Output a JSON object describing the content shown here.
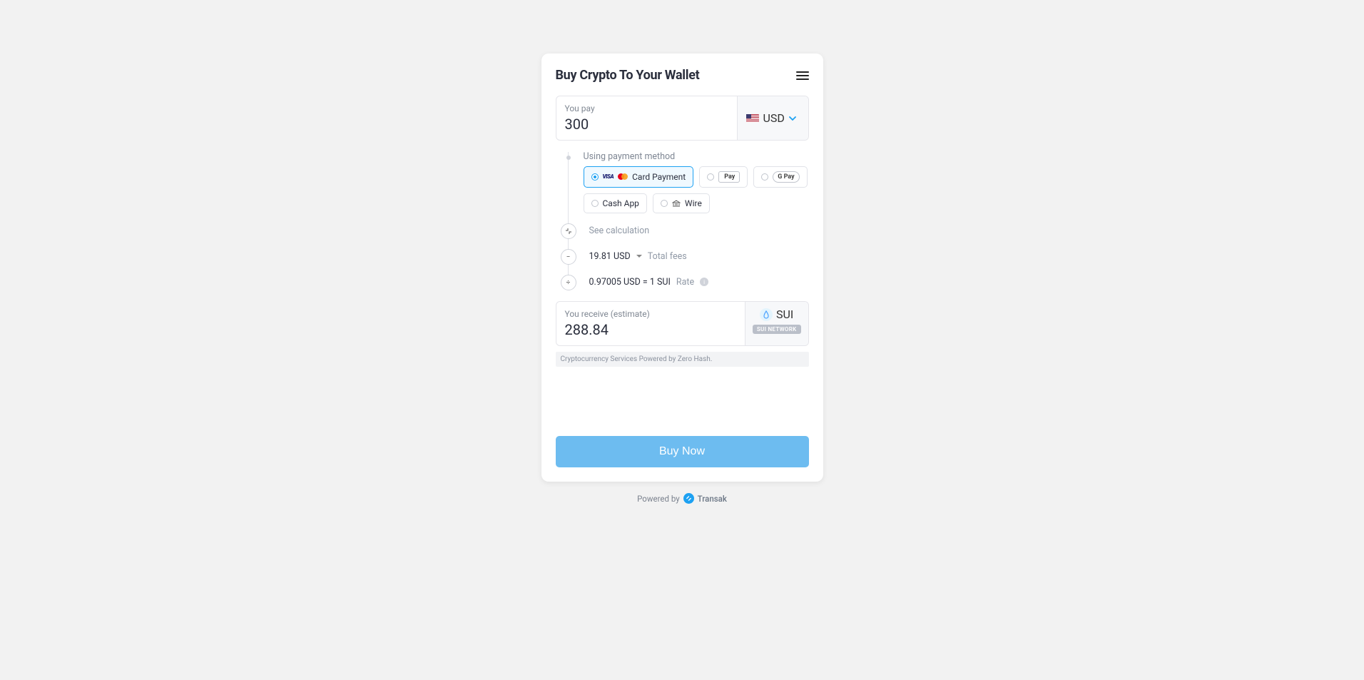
{
  "header": {
    "title": "Buy Crypto To Your Wallet"
  },
  "pay": {
    "label": "You pay",
    "amount": "300",
    "currency": "USD"
  },
  "payment": {
    "label": "Using payment method",
    "methods": {
      "card": "Card Payment",
      "apple_pay": "Pay",
      "google_pay": "G Pay",
      "cash_app": "Cash App",
      "wire": "Wire"
    }
  },
  "calc": {
    "see_calc": "See calculation",
    "fees_amount": "19.81 USD",
    "fees_label": "Total fees",
    "rate_text": "0.97005 USD = 1 SUI",
    "rate_label": "Rate"
  },
  "receive": {
    "label": "You receive (estimate)",
    "amount": "288.84",
    "code": "SUI",
    "network": "SUI NETWORK"
  },
  "disclaimer": "Cryptocurrency Services Powered by Zero Hash.",
  "cta": "Buy Now",
  "footer": {
    "prefix": "Powered by",
    "brand": "Transak"
  }
}
